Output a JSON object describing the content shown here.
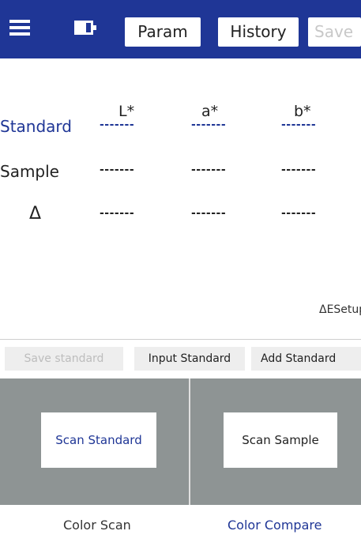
{
  "toolbar": {
    "param_label": "Param",
    "history_label": "History",
    "save_label": "Save"
  },
  "table": {
    "columns": [
      "L*",
      "a*",
      "b*"
    ],
    "rows": [
      {
        "label": "Standard",
        "values": [
          "-------",
          "-------",
          "-------"
        ],
        "color": "#1f3696"
      },
      {
        "label": "Sample",
        "values": [
          "-------",
          "-------",
          "-------"
        ]
      },
      {
        "label": "Δ",
        "values": [
          "-------",
          "-------",
          "-------"
        ]
      }
    ]
  },
  "de_setup_label": "ΔESetup",
  "actions": {
    "save_standard": "Save standard",
    "input_standard": "Input Standard",
    "add_standard": "Add Standard"
  },
  "scan": {
    "standard_label": "Scan Standard",
    "sample_label": "Scan Sample"
  },
  "tabs": {
    "color_scan": "Color Scan",
    "color_compare": "Color Compare"
  },
  "colors": {
    "brand": "#1f3696",
    "panel": "#8e9494",
    "disabled_text": "#bdbdbd"
  },
  "icons": [
    "menu-icon",
    "battery-icon"
  ]
}
